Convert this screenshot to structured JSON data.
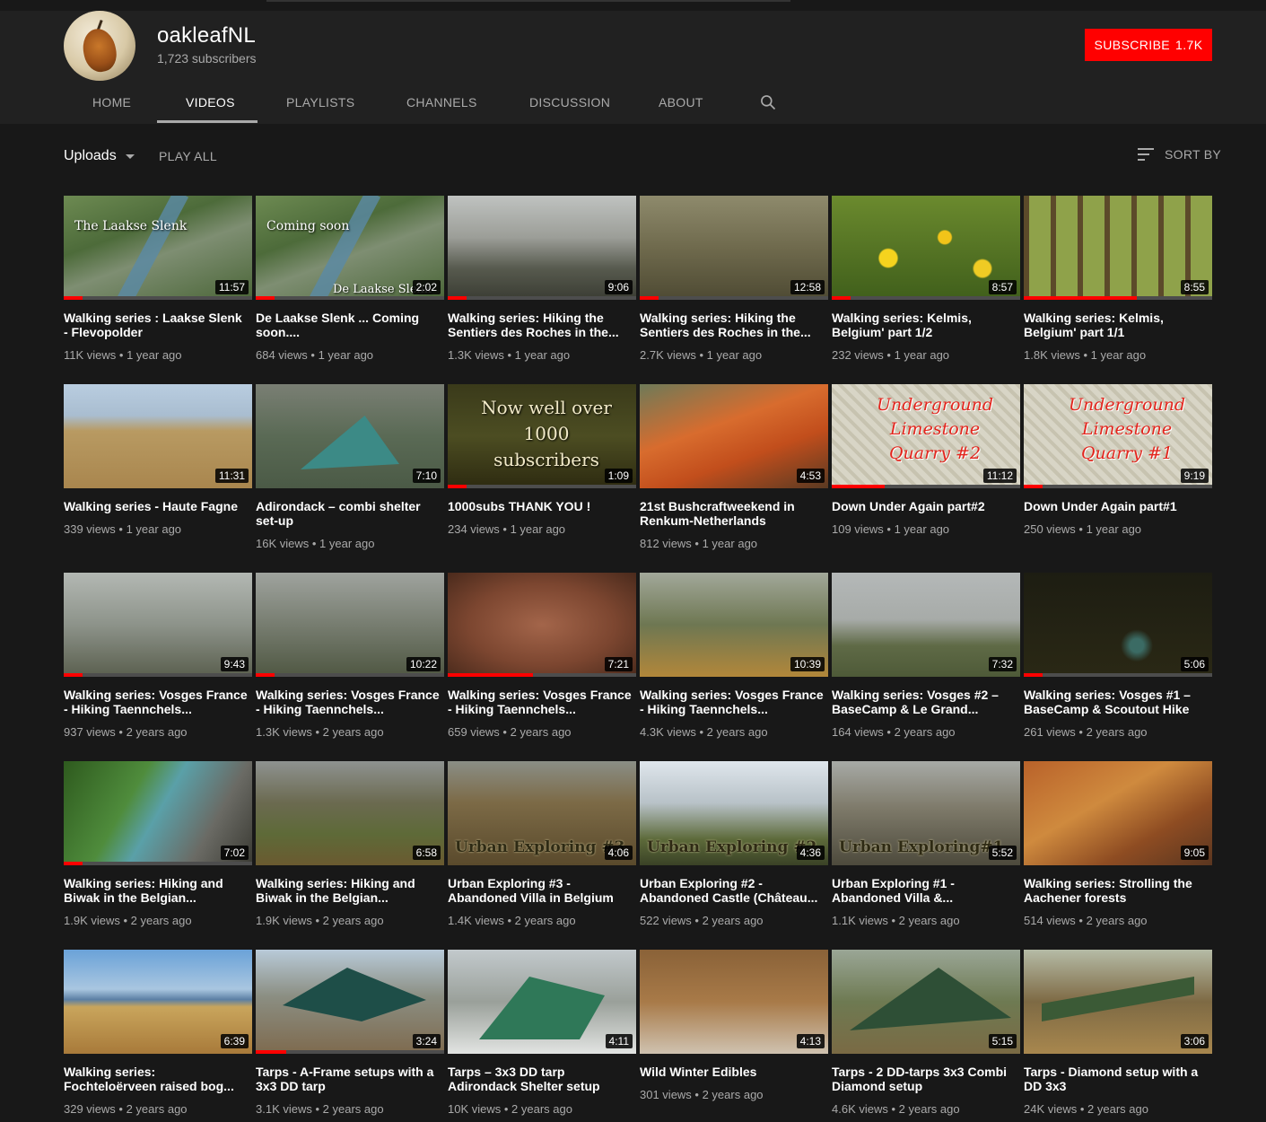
{
  "channel": {
    "name": "oakleafNL",
    "subscribers": "1,723 subscribers",
    "subscribe_label": "SUBSCRIBE",
    "subscribe_count": "1.7K"
  },
  "tabs": [
    {
      "label": "HOME"
    },
    {
      "label": "VIDEOS",
      "active": true
    },
    {
      "label": "PLAYLISTS"
    },
    {
      "label": "CHANNELS"
    },
    {
      "label": "DISCUSSION"
    },
    {
      "label": "ABOUT"
    }
  ],
  "toolbar": {
    "uploads_label": "Uploads",
    "play_all_label": "PLAY ALL",
    "sort_label": "SORT BY"
  },
  "colors": {
    "background": "#181818",
    "header": "#212121",
    "accent": "#ff0000",
    "secondary_text": "#aaaaaa"
  },
  "videos": [
    {
      "title": "Walking series : Laakse Slenk - Flevopolder",
      "views": "11K views",
      "age": "1 year ago",
      "duration": "11:57",
      "overlay": "The Laakse Slenk",
      "progress": 0.1
    },
    {
      "title": "De Laakse Slenk ... Coming soon....",
      "views": "684 views",
      "age": "1 year ago",
      "duration": "2:02",
      "overlay": "Coming soon",
      "overlay2": "De Laakse Slenk",
      "progress": 0.1
    },
    {
      "title": "Walking series: Hiking the Sentiers des Roches in the...",
      "views": "1.3K views",
      "age": "1 year ago",
      "duration": "9:06",
      "progress": 0.1
    },
    {
      "title": "Walking series: Hiking the Sentiers des Roches in the...",
      "views": "2.7K views",
      "age": "1 year ago",
      "duration": "12:58",
      "progress": 0.1
    },
    {
      "title": "Walking series: Kelmis, Belgium' part 1/2",
      "views": "232 views",
      "age": "1 year ago",
      "duration": "8:57",
      "progress": 0.1
    },
    {
      "title": "Walking series: Kelmis, Belgium' part 1/1",
      "views": "1.8K views",
      "age": "1 year ago",
      "duration": "8:55",
      "progress": 0.6
    },
    {
      "title": "Walking series - Haute Fagne",
      "views": "339 views",
      "age": "1 year ago",
      "duration": "11:31"
    },
    {
      "title": "Adirondack – combi shelter set-up",
      "views": "16K views",
      "age": "1 year ago",
      "duration": "7:10"
    },
    {
      "title": "1000subs THANK YOU !",
      "views": "234 views",
      "age": "1 year ago",
      "duration": "1:09",
      "overlay": "Now well over 1000 subscribers",
      "progress": 0.1
    },
    {
      "title": "21st Bushcraftweekend in Renkum-Netherlands",
      "views": "812 views",
      "age": "1 year ago",
      "duration": "4:53"
    },
    {
      "title": "Down Under Again part#2",
      "views": "109 views",
      "age": "1 year ago",
      "duration": "11:12",
      "overlay": "Underground Limestone Quarry #2",
      "progress": 0.28
    },
    {
      "title": "Down Under Again part#1",
      "views": "250 views",
      "age": "1 year ago",
      "duration": "9:19",
      "overlay": "Underground Limestone Quarry #1",
      "progress": 0.1
    },
    {
      "title": "Walking series: Vosges France - Hiking Taennchels...",
      "views": "937 views",
      "age": "2 years ago",
      "duration": "9:43",
      "progress": 0.1
    },
    {
      "title": "Walking series: Vosges France - Hiking Taennchels...",
      "views": "1.3K views",
      "age": "2 years ago",
      "duration": "10:22",
      "progress": 0.1
    },
    {
      "title": "Walking series: Vosges France - Hiking Taennchels...",
      "views": "659 views",
      "age": "2 years ago",
      "duration": "7:21",
      "progress": 0.45
    },
    {
      "title": "Walking series: Vosges France - Hiking Taennchels...",
      "views": "4.3K views",
      "age": "2 years ago",
      "duration": "10:39"
    },
    {
      "title": "Walking series: Vosges #2 – BaseCamp & Le Grand...",
      "views": "164 views",
      "age": "2 years ago",
      "duration": "7:32"
    },
    {
      "title": "Walking series: Vosges #1 – BaseCamp & Scoutout Hike",
      "views": "261 views",
      "age": "2 years ago",
      "duration": "5:06",
      "progress": 0.1
    },
    {
      "title": "Walking series: Hiking and Biwak in the Belgian...",
      "views": "1.9K views",
      "age": "2 years ago",
      "duration": "7:02",
      "progress": 0.1
    },
    {
      "title": "Walking series: Hiking and Biwak in the Belgian...",
      "views": "1.9K views",
      "age": "2 years ago",
      "duration": "6:58"
    },
    {
      "title": "Urban Exploring #3 - Abandoned Villa in Belgium",
      "views": "1.4K views",
      "age": "2 years ago",
      "duration": "4:06",
      "overlay": "Urban Exploring #3"
    },
    {
      "title": "Urban Exploring #2 - Abandoned Castle (Château...",
      "views": "522 views",
      "age": "2 years ago",
      "duration": "4:36",
      "overlay": "Urban Exploring #2"
    },
    {
      "title": "Urban Exploring #1 - Abandoned Villa &...",
      "views": "1.1K views",
      "age": "2 years ago",
      "duration": "5:52",
      "overlay": "Urban Exploring#1"
    },
    {
      "title": "Walking series: Strolling the Aachener forests",
      "views": "514 views",
      "age": "2 years ago",
      "duration": "9:05"
    },
    {
      "title": "Walking series: Fochteloërveen raised bog...",
      "views": "329 views",
      "age": "2 years ago",
      "duration": "6:39"
    },
    {
      "title": "Tarps - A-Frame setups with a 3x3 DD tarp",
      "views": "3.1K views",
      "age": "2 years ago",
      "duration": "3:24",
      "progress": 0.16
    },
    {
      "title": "Tarps – 3x3 DD tarp Adirondack Shelter setup",
      "views": "10K views",
      "age": "2 years ago",
      "duration": "4:11"
    },
    {
      "title": "Wild Winter Edibles",
      "views": "301 views",
      "age": "2 years ago",
      "duration": "4:13"
    },
    {
      "title": "Tarps - 2 DD-tarps 3x3 Combi Diamond setup",
      "views": "4.6K views",
      "age": "2 years ago",
      "duration": "5:15"
    },
    {
      "title": "Tarps - Diamond setup with a DD 3x3",
      "views": "24K views",
      "age": "2 years ago",
      "duration": "3:06"
    }
  ]
}
